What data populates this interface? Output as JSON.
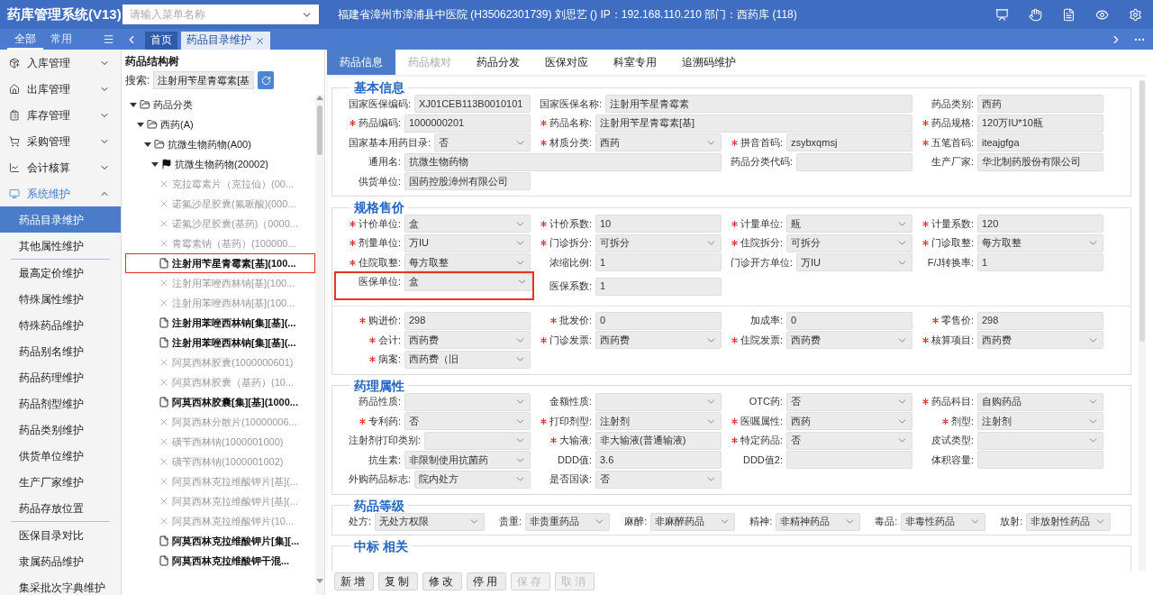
{
  "header": {
    "title": "药库管理系统(V13)",
    "menu_search": {
      "placeholder": "请输入菜单名称"
    },
    "info": "福建省漳州市漳浦县中医院 (H35062301739) 刘思艺 () IP：192.168.110.210 部门：西药库 (118)"
  },
  "sidebar": {
    "tabs": [
      {
        "label": "全部",
        "selected": true
      },
      {
        "label": "常用",
        "selected": false
      }
    ],
    "menu": [
      {
        "label": "入库管理",
        "expanded": false
      },
      {
        "label": "出库管理",
        "expanded": false
      },
      {
        "label": "库存管理",
        "expanded": false
      },
      {
        "label": "采购管理",
        "expanded": false
      },
      {
        "label": "会计核算",
        "expanded": false
      },
      {
        "label": "系统维护",
        "expanded": true,
        "submenu_groups": [
          [
            {
              "label": "药品目录维护",
              "selected": true
            },
            {
              "label": "其他属性维护",
              "selected": false
            }
          ],
          [
            {
              "label": "最高定价维护",
              "selected": false
            },
            {
              "label": "特殊属性维护",
              "selected": false
            },
            {
              "label": "特殊药品维护",
              "selected": false
            },
            {
              "label": "药品别名维护",
              "selected": false
            },
            {
              "label": "药品药理维护",
              "selected": false
            },
            {
              "label": "药品剂型维护",
              "selected": false
            },
            {
              "label": "药品类别维护",
              "selected": false
            },
            {
              "label": "供货单位维护",
              "selected": false
            },
            {
              "label": "生产厂家维护",
              "selected": false
            },
            {
              "label": "药品存放位置",
              "selected": false
            }
          ],
          [
            {
              "label": "医保目录对比",
              "selected": false
            },
            {
              "label": "隶属药品维护",
              "selected": false
            },
            {
              "label": "集采批次字典维护",
              "selected": false
            }
          ]
        ]
      }
    ]
  },
  "page_tabs": [
    {
      "label": "首页",
      "selected": false,
      "closable": false
    },
    {
      "label": "药品目录维护",
      "selected": true,
      "closable": true
    }
  ],
  "tree": {
    "title": "药品结构树",
    "search": {
      "label": "搜索:",
      "value": "注射用苄星青霉素[基"
    },
    "nodes": [
      {
        "label": "药品分类",
        "kind": "folder",
        "expanded": true,
        "selected": false,
        "children": [
          {
            "label": "西药(A)",
            "kind": "folder",
            "expanded": true,
            "selected": false,
            "children": [
              {
                "label": "抗微生物药物(A00)",
                "kind": "folder",
                "expanded": true,
                "selected": false,
                "children": [
                  {
                    "label": "抗微生物药物(20002)",
                    "kind": "flag",
                    "expanded": true,
                    "selected": false,
                    "children": [
                      {
                        "label": "克拉霉素片（克拉仙）(00...",
                        "kind": "stopped",
                        "selected": false
                      },
                      {
                        "label": "诺氟沙星胶囊(氟哌酸)(000...",
                        "kind": "stopped",
                        "selected": false
                      },
                      {
                        "label": "诺氟沙星胶囊(基药)（0000...",
                        "kind": "stopped",
                        "selected": false
                      },
                      {
                        "label": "青霉素钠（基药）(100000...",
                        "kind": "stopped",
                        "selected": false
                      },
                      {
                        "label": "注射用苄星青霉素[基](100...",
                        "kind": "drug",
                        "selected": true
                      },
                      {
                        "label": "注射用苯唑西林钠[基](100...",
                        "kind": "stopped",
                        "selected": false
                      },
                      {
                        "label": "注射用苯唑西林钠[基](100...",
                        "kind": "stopped",
                        "selected": false
                      },
                      {
                        "label": "注射用苯唑西林钠[集][基](...",
                        "kind": "drug",
                        "selected": false
                      },
                      {
                        "label": "注射用苯唑西林钠[集][基](...",
                        "kind": "drug",
                        "selected": false
                      },
                      {
                        "label": "阿莫西林胶囊(1000000601)",
                        "kind": "stopped",
                        "selected": false
                      },
                      {
                        "label": "阿莫西林胶囊（基药）(10...",
                        "kind": "stopped",
                        "selected": false
                      },
                      {
                        "label": "阿莫西林胶囊[集][基](1000...",
                        "kind": "drug",
                        "selected": false
                      },
                      {
                        "label": "阿莫西林分散片(10000006...",
                        "kind": "stopped",
                        "selected": false
                      },
                      {
                        "label": "磺苄西林钠(1000001000)",
                        "kind": "stopped",
                        "selected": false
                      },
                      {
                        "label": "磺苄西林钠(1000001002)",
                        "kind": "stopped",
                        "selected": false
                      },
                      {
                        "label": "阿莫西林克拉维酸钾片[基](...",
                        "kind": "stopped",
                        "selected": false
                      },
                      {
                        "label": "阿莫西林克拉维酸钾片[基](...",
                        "kind": "stopped",
                        "selected": false
                      },
                      {
                        "label": "阿莫西林克拉维酸钾片(10...",
                        "kind": "stopped",
                        "selected": false
                      },
                      {
                        "label": "阿莫西林克拉维酸钾片[集][...",
                        "kind": "drug",
                        "selected": false
                      },
                      {
                        "label": "阿莫西林克拉维酸钾干混...",
                        "kind": "drug",
                        "selected": false
                      }
                    ]
                  }
                ]
              }
            ]
          }
        ]
      }
    ]
  },
  "detail_tabs": [
    {
      "label": "药品信息",
      "selected": true,
      "disabled": false
    },
    {
      "label": "药品核对",
      "selected": false,
      "disabled": true
    },
    {
      "label": "药品分发",
      "selected": false,
      "disabled": false
    },
    {
      "label": "医保对应",
      "selected": false,
      "disabled": false
    },
    {
      "label": "科室专用",
      "selected": false,
      "disabled": false
    },
    {
      "label": "追溯码维护",
      "selected": false,
      "disabled": false
    }
  ],
  "sections": [
    {
      "title": "基本信息",
      "kind": "grid",
      "groups": [
        {
          "rows": [
            [
              {
                "label": "国家医保编码:",
                "value": "XJ01CEB113B0010101",
                "kind": "text",
                "required": false,
                "highlighted": false
              },
              {
                "label": "国家医保名称:",
                "value": "注射用苄星青霉素",
                "kind": "text",
                "required": false,
                "highlighted": false,
                "wide": true
              },
              {
                "label": "药品类别:",
                "value": "西药",
                "kind": "text",
                "required": false,
                "highlighted": false
              }
            ],
            [
              {
                "label": "药品编码:",
                "value": "1000000201",
                "kind": "text",
                "required": true,
                "highlighted": false
              },
              {
                "label": "药品名称:",
                "value": "注射用苄星青霉素[基]",
                "kind": "text",
                "required": true,
                "highlighted": false,
                "wide": true
              },
              {
                "label": "药品规格:",
                "value": "120万IU*10瓶",
                "kind": "text",
                "required": true,
                "highlighted": false
              }
            ],
            [
              {
                "label": "国家基本用药目录:",
                "value": "否",
                "kind": "select",
                "required": false,
                "highlighted": false
              },
              {
                "label": "材质分类:",
                "value": "西药",
                "kind": "select",
                "required": true,
                "highlighted": false
              },
              {
                "label": "拼音首码:",
                "value": "zsybxqmsj",
                "kind": "text",
                "required": true,
                "highlighted": false
              },
              {
                "label": "五笔首码:",
                "value": "iteajgfga",
                "kind": "text",
                "required": true,
                "highlighted": false
              }
            ],
            [
              {
                "label": "通用名:",
                "value": "抗微生物药物",
                "kind": "text",
                "required": false,
                "highlighted": false,
                "wide": true
              },
              {
                "label": "药品分类代码:",
                "kind": "text",
                "required": false,
                "highlighted": false
              },
              {
                "label": "生产厂家:",
                "value": "华北制药股份有限公司",
                "kind": "text",
                "required": false,
                "highlighted": false
              }
            ],
            [
              {
                "label": "供货单位:",
                "value": "国药控股漳州有限公司",
                "kind": "text",
                "required": false,
                "highlighted": false
              }
            ]
          ]
        }
      ]
    },
    {
      "title": "规格售价",
      "kind": "grid",
      "groups": [
        {
          "rows": [
            [
              {
                "label": "计价单位:",
                "value": "盒",
                "kind": "select",
                "required": true,
                "highlighted": false
              },
              {
                "label": "计价系数:",
                "value": "10",
                "kind": "text",
                "required": true,
                "highlighted": false
              },
              {
                "label": "计量单位:",
                "value": "瓶",
                "kind": "select",
                "required": true,
                "highlighted": false
              },
              {
                "label": "计量系数:",
                "value": "120",
                "kind": "text",
                "required": true,
                "highlighted": false
              }
            ],
            [
              {
                "label": "剂量单位:",
                "value": "万IU",
                "kind": "select",
                "required": true,
                "highlighted": false
              },
              {
                "label": "门诊拆分:",
                "value": "可拆分",
                "kind": "select",
                "required": true,
                "highlighted": false
              },
              {
                "label": "住院拆分:",
                "value": "可拆分",
                "kind": "select",
                "required": true,
                "highlighted": false
              },
              {
                "label": "门诊取整:",
                "value": "每方取整",
                "kind": "select",
                "required": true,
                "highlighted": false
              }
            ],
            [
              {
                "label": "住院取整:",
                "value": "每方取整",
                "kind": "select",
                "required": true,
                "highlighted": false
              },
              {
                "label": "浓缩比例:",
                "value": "1",
                "kind": "text",
                "required": false,
                "highlighted": false
              },
              {
                "label": "门诊开方单位:",
                "value": "万IU",
                "kind": "select",
                "required": false,
                "highlighted": false
              },
              {
                "label": "F/J转换率:",
                "value": "1",
                "kind": "text",
                "required": false,
                "highlighted": false
              }
            ],
            [
              {
                "label": "医保单位:",
                "value": "盒",
                "kind": "select",
                "required": false,
                "highlighted": true
              },
              {
                "label": "医保系数:",
                "value": "1",
                "kind": "text",
                "required": false,
                "highlighted": false
              }
            ]
          ]
        },
        {
          "rows": [
            [
              {
                "label": "购进价:",
                "value": "298",
                "kind": "text",
                "required": true,
                "highlighted": false
              },
              {
                "label": "批发价:",
                "value": "0",
                "kind": "text",
                "required": true,
                "highlighted": false
              },
              {
                "label": "加成率:",
                "value": "0",
                "kind": "text",
                "required": false,
                "highlighted": false
              },
              {
                "label": "零售价:",
                "value": "298",
                "kind": "text",
                "required": true,
                "highlighted": false
              }
            ],
            [
              {
                "label": "会计:",
                "value": "西药费",
                "kind": "select",
                "required": true,
                "highlighted": false
              },
              {
                "label": "门诊发票:",
                "value": "西药费",
                "kind": "select",
                "required": true,
                "highlighted": false
              },
              {
                "label": "住院发票:",
                "value": "西药费",
                "kind": "select",
                "required": true,
                "highlighted": false
              },
              {
                "label": "核算项目:",
                "value": "西药费",
                "kind": "select",
                "required": true,
                "highlighted": false
              }
            ],
            [
              {
                "label": "病案:",
                "value": "西药费（旧",
                "kind": "select",
                "required": true,
                "highlighted": false
              }
            ]
          ]
        }
      ]
    },
    {
      "title": "药理属性",
      "kind": "grid",
      "groups": [
        {
          "rows": [
            [
              {
                "label": "药品性质:",
                "kind": "select",
                "required": false,
                "highlighted": false
              },
              {
                "label": "金额性质:",
                "kind": "select",
                "required": false,
                "highlighted": false
              },
              {
                "label": "OTC药:",
                "value": "否",
                "kind": "select",
                "required": false,
                "highlighted": false
              },
              {
                "label": "药品科目:",
                "value": "自购药品",
                "kind": "select",
                "required": true,
                "highlighted": false
              }
            ],
            [
              {
                "label": "专利药:",
                "value": "否",
                "kind": "select",
                "required": true,
                "highlighted": false
              },
              {
                "label": "打印剂型:",
                "value": "注射剂",
                "kind": "select",
                "required": true,
                "highlighted": false
              },
              {
                "label": "医嘱属性:",
                "value": "西药",
                "kind": "select",
                "required": true,
                "highlighted": false
              },
              {
                "label": "剂型:",
                "value": "注射剂",
                "kind": "select",
                "required": true,
                "highlighted": false
              }
            ],
            [
              {
                "label": "注射剂打印类别:",
                "kind": "select",
                "required": false,
                "highlighted": false
              },
              {
                "label": "大输液:",
                "value": "非大输液(普通输液)",
                "kind": "text",
                "required": true,
                "highlighted": false
              },
              {
                "label": "特定药品:",
                "value": "否",
                "kind": "select",
                "required": true,
                "highlighted": false
              },
              {
                "label": "皮试类型:",
                "kind": "select",
                "required": false,
                "highlighted": false
              }
            ],
            [
              {
                "label": "抗生素:",
                "value": "非限制使用抗菌药",
                "kind": "select",
                "required": false,
                "highlighted": false
              },
              {
                "label": "DDD值:",
                "value": "3.6",
                "kind": "text",
                "required": false,
                "highlighted": false
              },
              {
                "label": "DDD值2:",
                "kind": "text",
                "required": false,
                "highlighted": false
              },
              {
                "label": "体积容量:",
                "kind": "text",
                "required": false,
                "highlighted": false
              }
            ],
            [
              {
                "label": "外购药品标志:",
                "value": "院内处方",
                "kind": "select",
                "required": false,
                "highlighted": false
              },
              {
                "label": "是否国谈:",
                "value": "否",
                "kind": "select",
                "required": false,
                "highlighted": false
              }
            ]
          ]
        }
      ]
    },
    {
      "title": "药品等级",
      "kind": "inline",
      "groups": [
        {
          "rows": [
            [
              {
                "label": "处方:",
                "value": "无处方权限",
                "kind": "select",
                "required": false,
                "highlighted": false
              },
              {
                "label": "贵重:",
                "value": "非贵重药品",
                "kind": "select",
                "required": false,
                "highlighted": false
              },
              {
                "label": "麻醉:",
                "value": "非麻醉药品",
                "kind": "select",
                "required": false,
                "highlighted": false
              },
              {
                "label": "精神:",
                "value": "非精神药品",
                "kind": "select",
                "required": false,
                "highlighted": false
              },
              {
                "label": "毒品:",
                "value": "非毒性药品",
                "kind": "select",
                "required": false,
                "highlighted": false
              },
              {
                "label": "放射:",
                "value": "非放射性药品",
                "kind": "select",
                "required": false,
                "highlighted": false
              }
            ]
          ]
        }
      ]
    },
    {
      "title": "中标 相关",
      "kind": "grid"
    }
  ],
  "buttons": [
    {
      "label": "新增",
      "disabled": false
    },
    {
      "label": "复制",
      "disabled": false
    },
    {
      "label": "修改",
      "disabled": false
    },
    {
      "label": "停用",
      "disabled": false
    },
    {
      "label": "保存",
      "disabled": true
    },
    {
      "label": "取消",
      "disabled": true
    }
  ]
}
